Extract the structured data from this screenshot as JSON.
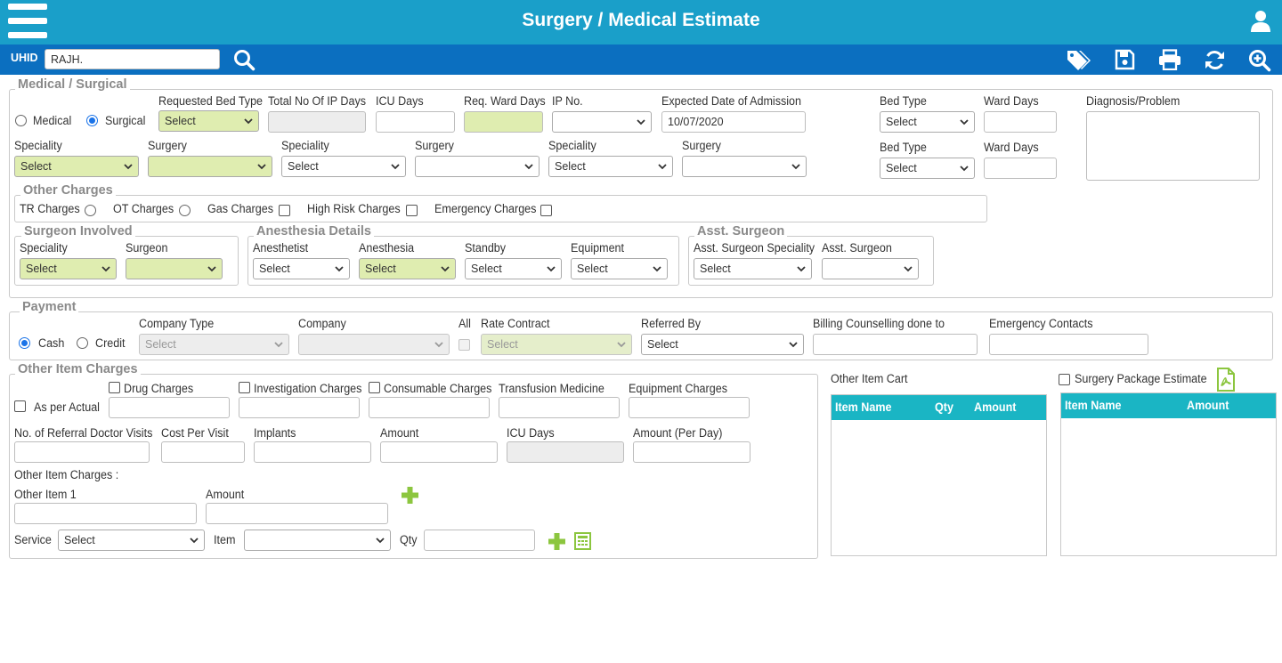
{
  "header": {
    "title": "Surgery / Medical Estimate",
    "uhid_label": "UHID",
    "uhid_value": "RAJH."
  },
  "icons": {
    "menu": "hamburger-menu-icon",
    "user": "user-icon",
    "search": "search-icon",
    "tags": "tags-icon",
    "save": "floppy-disk-icon",
    "print": "printer-icon",
    "refresh": "refresh-icon",
    "zoom": "zoom-in-icon",
    "add": "plus-icon",
    "calculator": "calculator-icon",
    "pdf": "pdf-file-icon"
  },
  "colors": {
    "topbar": "#1a9fc9",
    "subbar": "#0b6fc0",
    "required": "#dfedb0",
    "table_header": "#1ab5c4",
    "add_icon": "#8cc63f"
  },
  "medical": {
    "legend": "Medical / Surgical",
    "radio_medical": "Medical",
    "radio_surgical": "Surgical",
    "req_bed_type": "Requested Bed Type",
    "req_bed_type_value": "Select",
    "total_ip_days": "Total No Of IP Days",
    "icu_days": "ICU Days",
    "req_ward_days": "Req. Ward Days",
    "ip_no": "IP No.",
    "expected_date": "Expected Date of Admission",
    "expected_date_value": "10/07/2020",
    "bed_type": "Bed Type",
    "ward_days": "Ward Days",
    "diagnosis": "Diagnosis/Problem",
    "speciality": "Speciality",
    "surgery": "Surgery",
    "select": "Select"
  },
  "other_charges": {
    "legend": "Other Charges",
    "tr": "TR Charges",
    "ot": "OT Charges",
    "gas": "Gas Charges",
    "high_risk": "High Risk Charges",
    "emergency": "Emergency Charges"
  },
  "surgeon_involved": {
    "legend": "Surgeon Involved",
    "speciality": "Speciality",
    "surgeon": "Surgeon"
  },
  "anesthesia": {
    "legend": "Anesthesia Details",
    "anesthetist": "Anesthetist",
    "anesthesia": "Anesthesia",
    "standby": "Standby",
    "equipment": "Equipment"
  },
  "asst": {
    "legend": "Asst. Surgeon",
    "speciality": "Asst. Surgeon Speciality",
    "surgeon": "Asst. Surgeon"
  },
  "payment": {
    "legend": "Payment",
    "cash": "Cash",
    "credit": "Credit",
    "company_type": "Company Type",
    "company": "Company",
    "all": "All",
    "rate_contract": "Rate Contract",
    "referred_by": "Referred By",
    "billing": "Billing Counselling done to",
    "emergency_contacts": "Emergency Contacts"
  },
  "other_items": {
    "legend": "Other Item Charges",
    "as_per_actual": "As per Actual",
    "drug": "Drug Charges",
    "investigation": "Investigation Charges",
    "consumable": "Consumable Charges",
    "transfusion": "Transfusion Medicine",
    "equipment": "Equipment Charges",
    "referral_visits": "No. of Referral Doctor Visits",
    "cost_per_visit": "Cost Per Visit",
    "implants": "Implants",
    "amount": "Amount",
    "icu_days": "ICU Days",
    "amount_per_day": "Amount (Per Day)",
    "other_item_charges": "Other Item Charges :",
    "other_item_1": "Other Item 1",
    "service": "Service",
    "item": "Item",
    "qty": "Qty"
  },
  "cart": {
    "title": "Other Item Cart",
    "columns": [
      "Item Name",
      "Qty",
      "Amount"
    ]
  },
  "package": {
    "title": "Surgery Package Estimate",
    "columns": [
      "Item Name",
      "Amount"
    ]
  }
}
